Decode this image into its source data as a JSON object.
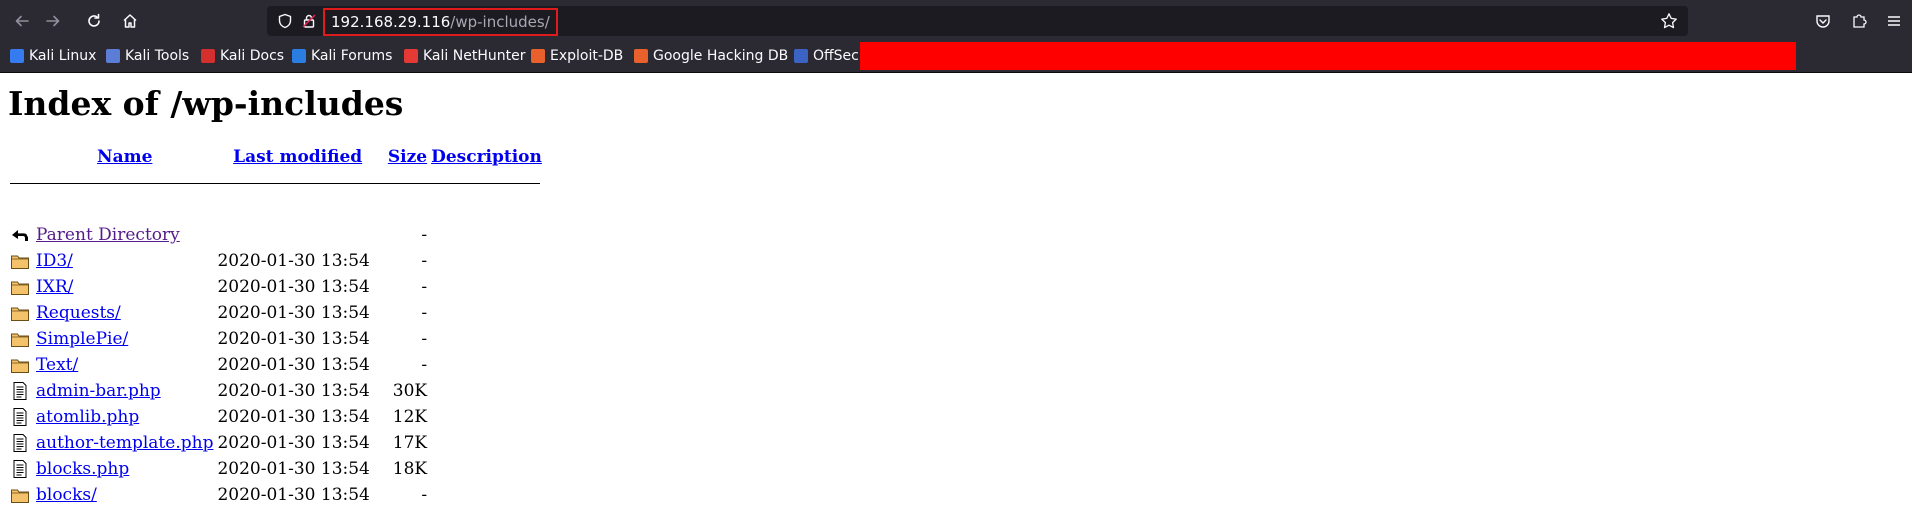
{
  "browser": {
    "url_host": "192.168.29.116",
    "url_path": "/wp-includes/",
    "bookmarks": [
      {
        "label": "Kali Linux",
        "color": "#367bf0"
      },
      {
        "label": "Kali Tools",
        "color": "#5b7dd6"
      },
      {
        "label": "Kali Docs",
        "color": "#d32f2f"
      },
      {
        "label": "Kali Forums",
        "color": "#2a7de1"
      },
      {
        "label": "Kali NetHunter",
        "color": "#e53935"
      },
      {
        "label": "Exploit-DB",
        "color": "#e8612c"
      },
      {
        "label": "Google Hacking DB",
        "color": "#e8612c"
      },
      {
        "label": "OffSec",
        "color": "#3b63c4"
      }
    ]
  },
  "page": {
    "title": "Index of /wp-includes",
    "headers": {
      "name": "Name",
      "last_modified": "Last modified",
      "size": "Size",
      "description": "Description"
    },
    "rows": [
      {
        "icon": "back",
        "name": "Parent Directory",
        "date": "",
        "size": "-",
        "visited": true
      },
      {
        "icon": "folder",
        "name": "ID3/",
        "date": "2020-01-30 13:54",
        "size": "-"
      },
      {
        "icon": "folder",
        "name": "IXR/",
        "date": "2020-01-30 13:54",
        "size": "-"
      },
      {
        "icon": "folder",
        "name": "Requests/",
        "date": "2020-01-30 13:54",
        "size": "-"
      },
      {
        "icon": "folder",
        "name": "SimplePie/",
        "date": "2020-01-30 13:54",
        "size": "-"
      },
      {
        "icon": "folder",
        "name": "Text/",
        "date": "2020-01-30 13:54",
        "size": "-"
      },
      {
        "icon": "file",
        "name": "admin-bar.php",
        "date": "2020-01-30 13:54",
        "size": "30K"
      },
      {
        "icon": "file",
        "name": "atomlib.php",
        "date": "2020-01-30 13:54",
        "size": "12K"
      },
      {
        "icon": "file",
        "name": "author-template.php",
        "date": "2020-01-30 13:54",
        "size": "17K"
      },
      {
        "icon": "file",
        "name": "blocks.php",
        "date": "2020-01-30 13:54",
        "size": "18K"
      },
      {
        "icon": "folder",
        "name": "blocks/",
        "date": "2020-01-30 13:54",
        "size": "-"
      }
    ]
  }
}
